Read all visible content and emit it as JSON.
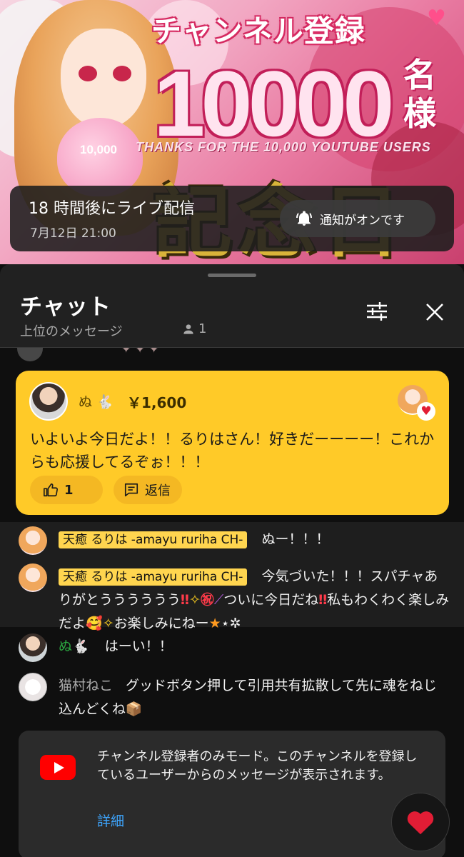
{
  "banner": {
    "title_ja": "チャンネル登録",
    "title_number": "10000",
    "title_suffix": "名様",
    "thanks_text": "THANKS FOR THE 10,000 YOUTUBE USERS",
    "kinen_text": "記念日",
    "pillow_text": "10,000"
  },
  "live": {
    "title": "18 時間後にライブ配信",
    "datetime": "7月12日 21:00",
    "notify_label": "通知がオンです"
  },
  "chat": {
    "title": "チャット",
    "filter": "上位のメッセージ",
    "viewer_count": "1"
  },
  "superchat": {
    "author": "ぬ",
    "author_badge": "🐇",
    "amount": "￥1,600",
    "message": "いよいよ今日だよ！！るりはさん！好きだーーーー！これからも応援してるぞぉ！！！",
    "like_count": "1",
    "reply_label": "返信",
    "heart": "♥",
    "colors": {
      "card": "#ffca28",
      "button": "#f4b823"
    }
  },
  "messages": [
    {
      "author": "天癒 るりは -amayu ruriha CH-",
      "text": "ぬー！！！"
    },
    {
      "author": "天癒 るりは -amayu ruriha CH-",
      "parts": [
        "今気づいた！！！スパチャありがとうううううう",
        "‼",
        "✧",
        "㊗",
        "⟋",
        "ついに今日だね",
        "‼",
        "私もわくわく楽しみだよ",
        "🥰",
        "✧",
        "お楽しみにねー",
        "★",
        "⋆✲"
      ]
    },
    {
      "author": "ぬ",
      "author_badge": "🐇",
      "text": "はーい！！"
    },
    {
      "author": "猫村ねこ",
      "text": "グッドボタン押して引用共有拡散して先に魂をねじ込んどくね",
      "emoji": "📦"
    }
  ],
  "notice": {
    "text": "チャンネル登録者のみモード。このチャンネルを登録しているユーザーからのメッセージが表示されます。",
    "link": "詳細"
  },
  "icons": {
    "bell": "bell-icon",
    "tune": "tune-icon",
    "close": "close-icon",
    "person": "person-icon",
    "like": "thumbs-up-icon",
    "reply": "reply-icon",
    "youtube": "youtube-icon",
    "heart": "heart-icon"
  },
  "colors": {
    "background": "#0f0f0f",
    "sheet": "#212121",
    "owner_badge": "#ffd54f",
    "member_name": "#2ba640",
    "link": "#3ea6ff",
    "heart": "#e21d35"
  }
}
